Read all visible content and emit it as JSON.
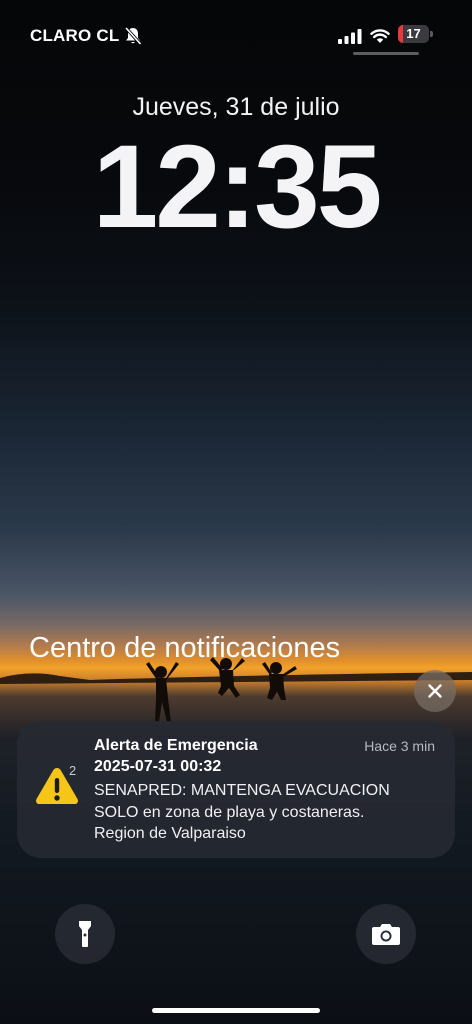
{
  "status_bar": {
    "carrier": "CLARO CL",
    "battery_level": "17",
    "battery_fraction": 0.17,
    "icons": [
      "bell-slash-icon",
      "cellular-signal-icon",
      "wifi-icon",
      "battery-icon"
    ]
  },
  "lock_screen": {
    "date": "Jueves, 31 de julio",
    "time": "12:35"
  },
  "notification_center": {
    "title": "Centro de notificaciones",
    "notification": {
      "app_icon": "warning-triangle-icon",
      "count": "2",
      "title": "Alerta de Emergencia",
      "time": "Hace 3 min",
      "subtitle": "2025-07-31 00:32",
      "body_lines": [
        "SENAPRED: MANTENGA EVACUACION",
        "SOLO en zona de playa y costaneras.",
        "Region de Valparaiso"
      ]
    }
  },
  "bottom_controls": {
    "left": "flashlight-icon",
    "right": "camera-icon"
  },
  "colors": {
    "battery_low": "#e5393b",
    "warning_yellow": "#f5c518",
    "notification_bg": "#262a32"
  }
}
